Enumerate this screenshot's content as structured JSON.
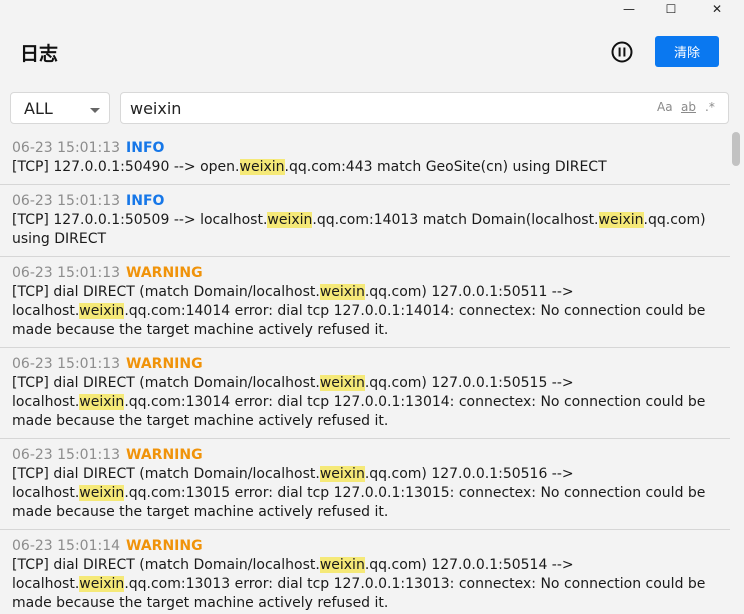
{
  "window": {
    "close_glyph": "✕",
    "max_glyph": "☐",
    "min_glyph": "—"
  },
  "header": {
    "title": "日志",
    "clear_label": "清除"
  },
  "filter": {
    "level": "ALL",
    "search_value": "weixin",
    "opt_case": "Aa",
    "opt_word": "ab",
    "opt_regex": ".*"
  },
  "colors": {
    "accent": "#0a78f0",
    "info": "#1677e8",
    "warning": "#f0930a",
    "highlight": "#f5e978"
  },
  "logs": [
    {
      "time": "06-23 15:01:13",
      "level": "INFO",
      "type": "info",
      "message": "[TCP] 127.0.0.1:50490 --> open.weixin.qq.com:443 match GeoSite(cn) using DIRECT"
    },
    {
      "time": "06-23 15:01:13",
      "level": "INFO",
      "type": "info",
      "message": "[TCP] 127.0.0.1:50509 --> localhost.weixin.qq.com:14013 match Domain(localhost.weixin.qq.com) using DIRECT"
    },
    {
      "time": "06-23 15:01:13",
      "level": "WARNING",
      "type": "warning",
      "message": "[TCP] dial DIRECT (match Domain/localhost.weixin.qq.com) 127.0.0.1:50511 --> localhost.weixin.qq.com:14014 error: dial tcp 127.0.0.1:14014: connectex: No connection could be made because the target machine actively refused it."
    },
    {
      "time": "06-23 15:01:13",
      "level": "WARNING",
      "type": "warning",
      "message": "[TCP] dial DIRECT (match Domain/localhost.weixin.qq.com) 127.0.0.1:50515 --> localhost.weixin.qq.com:13014 error: dial tcp 127.0.0.1:13014: connectex: No connection could be made because the target machine actively refused it."
    },
    {
      "time": "06-23 15:01:13",
      "level": "WARNING",
      "type": "warning",
      "message": "[TCP] dial DIRECT (match Domain/localhost.weixin.qq.com) 127.0.0.1:50516 --> localhost.weixin.qq.com:13015 error: dial tcp 127.0.0.1:13015: connectex: No connection could be made because the target machine actively refused it."
    },
    {
      "time": "06-23 15:01:14",
      "level": "WARNING",
      "type": "warning",
      "message": "[TCP] dial DIRECT (match Domain/localhost.weixin.qq.com) 127.0.0.1:50514 --> localhost.weixin.qq.com:13013 error: dial tcp 127.0.0.1:13013: connectex: No connection could be made because the target machine actively refused it."
    }
  ]
}
